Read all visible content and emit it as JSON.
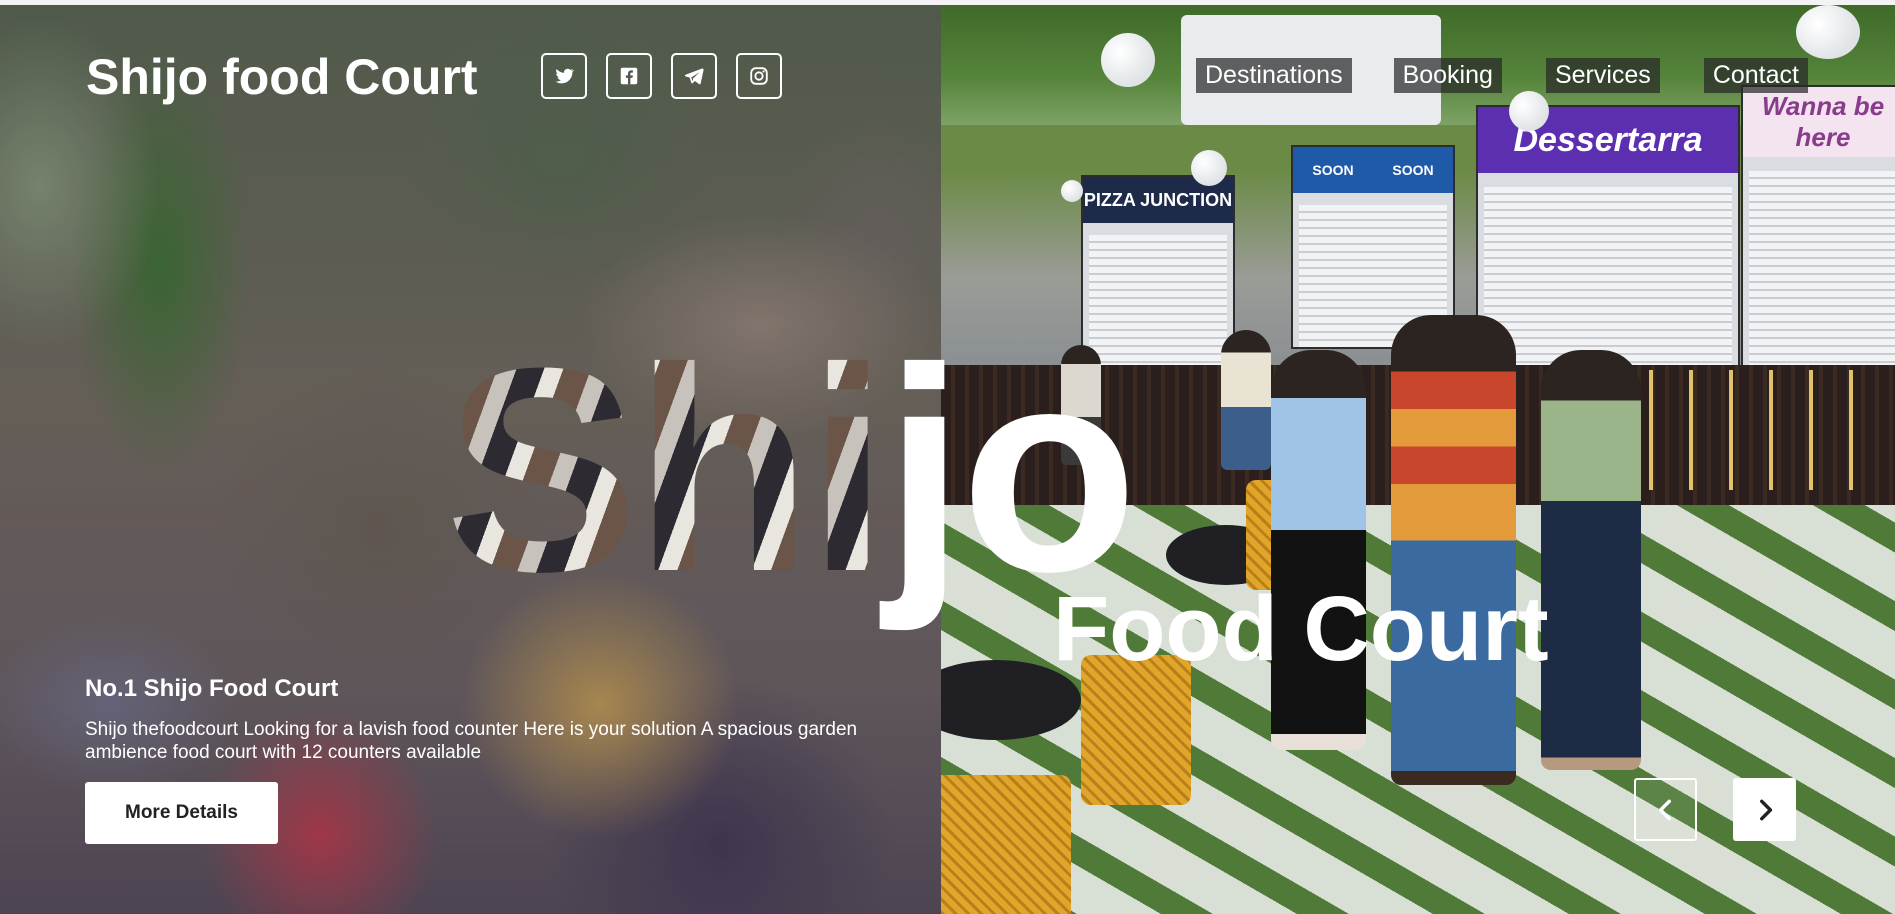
{
  "header": {
    "brand": "Shijo food Court",
    "social_icons": [
      "twitter-icon",
      "facebook-icon",
      "telegram-icon",
      "instagram-icon"
    ]
  },
  "nav": {
    "items": [
      {
        "label": "Destinations"
      },
      {
        "label": "Booking"
      },
      {
        "label": "Services"
      },
      {
        "label": "Contact"
      }
    ]
  },
  "hero": {
    "overlay_word_part1": "Shi",
    "overlay_word_part2": "jo",
    "overlay_subtitle": "Food Court",
    "slide_title": "No.1 Shijo Food Court",
    "slide_description": "Shijo thefoodcourt Looking for a lavish food counter Here is your solution A spacious garden ambience food court with 12 counters available",
    "more_button": "More Details",
    "prev_icon": "chevron-left-icon",
    "next_icon": "chevron-right-icon"
  },
  "background_photo": {
    "stall_signs": [
      "PIZZA JUNCTION",
      "SOON",
      "SOON",
      "Dessertarra",
      "Wanna be here"
    ]
  },
  "colors": {
    "text": "#ffffff",
    "nav_bg": "#282828",
    "button_bg": "#ffffff",
    "button_text": "#222222"
  }
}
